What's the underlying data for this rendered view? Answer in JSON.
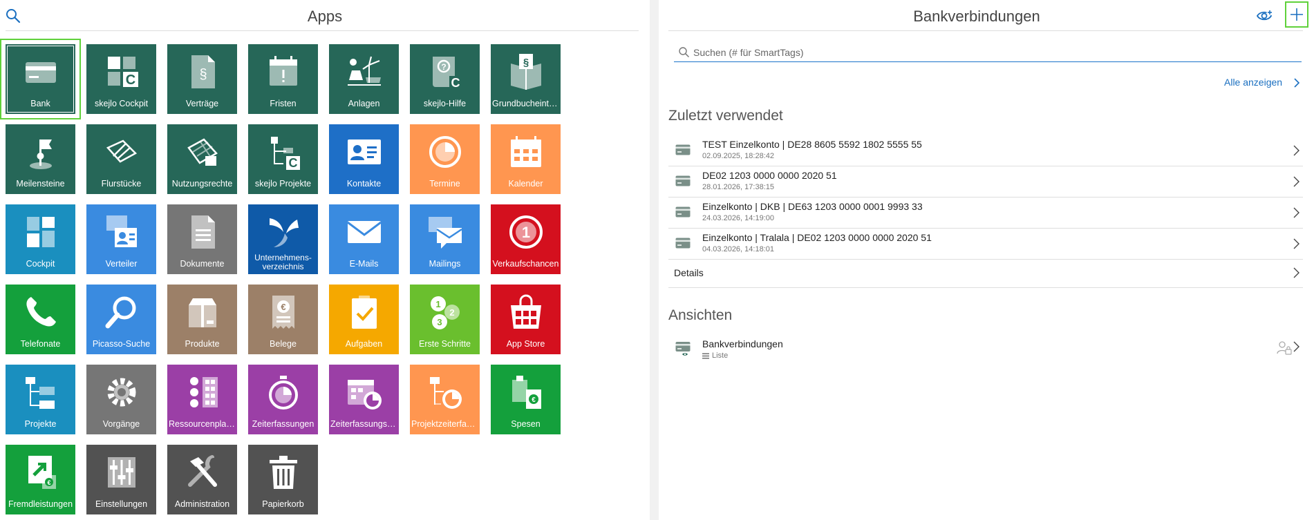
{
  "apps": {
    "title": "Apps",
    "tiles": [
      {
        "label": "Bank",
        "icon": "bank-card-icon",
        "color": "#266758",
        "selected": true
      },
      {
        "label": "skejlo Cockpit",
        "icon": "cockpit-c-icon",
        "color": "#266758"
      },
      {
        "label": "Verträge",
        "icon": "contract-icon",
        "color": "#266758"
      },
      {
        "label": "Fristen",
        "icon": "deadline-calendar-icon",
        "color": "#266758"
      },
      {
        "label": "Anlagen",
        "icon": "energy-plant-icon",
        "color": "#266758"
      },
      {
        "label": "skejlo-Hilfe",
        "icon": "help-book-icon",
        "color": "#266758"
      },
      {
        "label": "Grundbucheintr…",
        "icon": "land-register-icon",
        "color": "#266758"
      },
      {
        "label": "Meilensteine",
        "icon": "milestone-flag-icon",
        "color": "#266758"
      },
      {
        "label": "Flurstücke",
        "icon": "parcel-icon",
        "color": "#266758"
      },
      {
        "label": "Nutzungsrechte",
        "icon": "usage-rights-icon",
        "color": "#266758"
      },
      {
        "label": "skejlo Projekte",
        "icon": "project-tree-c-icon",
        "color": "#266758"
      },
      {
        "label": "Kontakte",
        "icon": "contact-card-icon",
        "color": "#1e6fc7"
      },
      {
        "label": "Termine",
        "icon": "appointment-clock-icon",
        "color": "#ff9650"
      },
      {
        "label": "Kalender",
        "icon": "calendar-icon",
        "color": "#ff9650"
      },
      {
        "label": "Cockpit",
        "icon": "cockpit-grid-icon",
        "color": "#1a8fbf"
      },
      {
        "label": "Verteiler",
        "icon": "distribution-list-icon",
        "color": "#3a8be0"
      },
      {
        "label": "Dokumente",
        "icon": "document-icon",
        "color": "#767676"
      },
      {
        "label": "Unternehmens-verzeichnis",
        "icon": "company-directory-icon",
        "color": "#0f5aa8"
      },
      {
        "label": "E-Mails",
        "icon": "mail-icon",
        "color": "#3a8be0"
      },
      {
        "label": "Mailings",
        "icon": "mailing-icon",
        "color": "#3a8be0"
      },
      {
        "label": "Verkaufschancen",
        "icon": "sales-opportunity-icon",
        "color": "#d4101e"
      },
      {
        "label": "Telefonate",
        "icon": "phone-icon",
        "color": "#14a03c"
      },
      {
        "label": "Picasso-Suche",
        "icon": "magnifier-icon",
        "color": "#3a8be0"
      },
      {
        "label": "Produkte",
        "icon": "product-box-icon",
        "color": "#9c8068"
      },
      {
        "label": "Belege",
        "icon": "receipt-icon",
        "color": "#9c8068"
      },
      {
        "label": "Aufgaben",
        "icon": "task-clipboard-icon",
        "color": "#f5a800"
      },
      {
        "label": "Erste Schritte",
        "icon": "first-steps-icon",
        "color": "#6abf2e"
      },
      {
        "label": "App Store",
        "icon": "app-store-bag-icon",
        "color": "#d4101e"
      },
      {
        "label": "Projekte",
        "icon": "project-tree-icon",
        "color": "#1a8fbf"
      },
      {
        "label": "Vorgänge",
        "icon": "process-gear-icon",
        "color": "#767676"
      },
      {
        "label": "Ressourcenplan…",
        "icon": "resource-plan-icon",
        "color": "#9b3fa6"
      },
      {
        "label": "Zeiterfassungen",
        "icon": "stopwatch-icon",
        "color": "#9b3fa6"
      },
      {
        "label": "Zeiterfassungsk…",
        "icon": "time-calendar-icon",
        "color": "#9b3fa6"
      },
      {
        "label": "Projektzeiterfass…",
        "icon": "project-time-icon",
        "color": "#ff9650"
      },
      {
        "label": "Spesen",
        "icon": "expenses-icon",
        "color": "#14a03c"
      },
      {
        "label": "Fremdleistungen",
        "icon": "external-services-icon",
        "color": "#14a03c"
      },
      {
        "label": "Einstellungen",
        "icon": "settings-sliders-icon",
        "color": "#525252"
      },
      {
        "label": "Administration",
        "icon": "tools-icon",
        "color": "#525252"
      },
      {
        "label": "Papierkorb",
        "icon": "trash-icon",
        "color": "#525252"
      }
    ]
  },
  "bank": {
    "title": "Bankverbindungen",
    "search_placeholder": "Suchen (# für SmartTags)",
    "show_all_label": "Alle anzeigen",
    "recent_title": "Zuletzt verwendet",
    "recent": [
      {
        "name": "TEST Einzelkonto | DE28 8605 5592 1802 5555 55",
        "date": "02.09.2025, 18:28:42"
      },
      {
        "name": "DE02 1203 0000 0000 2020 51",
        "date": "28.01.2026, 17:38:15"
      },
      {
        "name": "Einzelkonto | DKB | DE63 1203 0000 0001 9993 33",
        "date": "24.03.2026, 14:19:00"
      },
      {
        "name": "Einzelkonto | Tralala | DE02 1203 0000 0000 2020 51",
        "date": "04.03.2026, 14:18:01"
      }
    ],
    "details_label": "Details",
    "views_title": "Ansichten",
    "view": {
      "name": "Bankverbindungen",
      "type": "Liste"
    }
  }
}
